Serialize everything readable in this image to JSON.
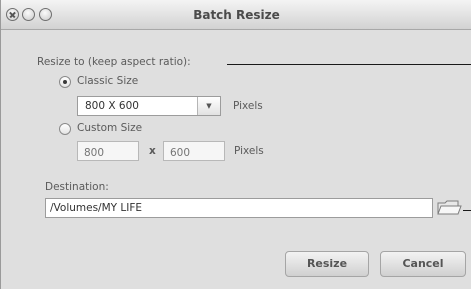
{
  "window": {
    "title": "Batch Resize"
  },
  "resize_section": {
    "heading": "Resize to (keep aspect ratio):",
    "classic_option_label": "Classic Size",
    "classic_selected": true,
    "size_select_value": "800 X 600",
    "size_unit": "Pixels",
    "custom_option_label": "Custom Size",
    "custom_selected": false,
    "custom_width_placeholder": "800",
    "custom_separator": "x",
    "custom_height_placeholder": "600",
    "custom_unit": "Pixels"
  },
  "destination": {
    "label": "Destination:",
    "path": "/Volumes/MY LIFE",
    "browse_icon": "folder-icon"
  },
  "buttons": {
    "resize_label": "Resize",
    "cancel_label": "Cancel"
  }
}
